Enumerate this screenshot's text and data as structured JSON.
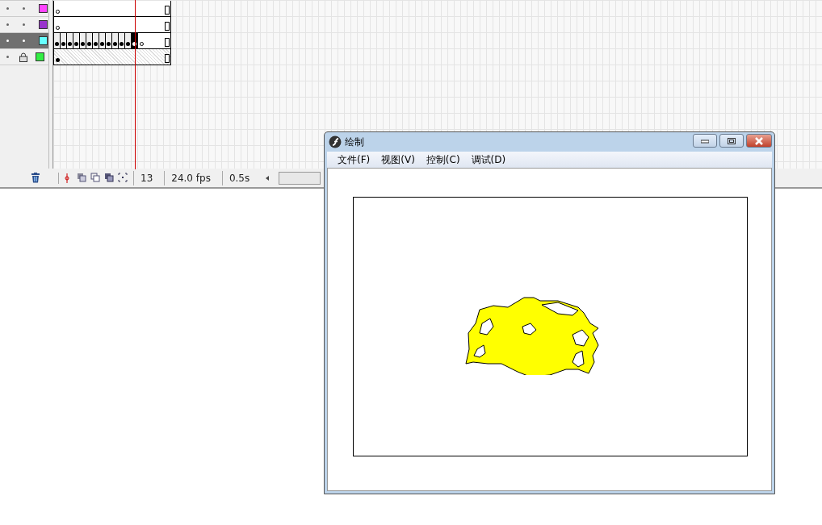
{
  "timeline": {
    "layers": [
      {
        "color": "#ff44ff",
        "selected": false,
        "locked": false,
        "kind": "empty"
      },
      {
        "color": "#9933cc",
        "selected": false,
        "locked": false,
        "kind": "empty"
      },
      {
        "color": "#66ffff",
        "selected": true,
        "locked": false,
        "kind": "animated"
      },
      {
        "color": "#33ee44",
        "selected": false,
        "locked": true,
        "kind": "filled"
      }
    ],
    "current_frame": "13",
    "frame_rate": "24.0 fps",
    "elapsed_time": "0.5s"
  },
  "window": {
    "title": "绘制",
    "menus": [
      "文件(F)",
      "视图(V)",
      "控制(C)",
      "调试(D)"
    ]
  }
}
